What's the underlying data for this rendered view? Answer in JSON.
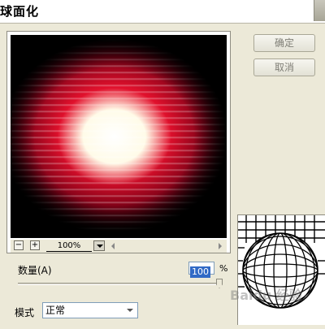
{
  "window": {
    "title": "球面化"
  },
  "buttons": {
    "ok_label": "确定",
    "cancel_label": "取消"
  },
  "preview": {
    "zoom_value": "100%",
    "zoom_out_label": "−",
    "zoom_in_label": "+"
  },
  "amount": {
    "label": "数量(A)",
    "value": "100",
    "unit": "%"
  },
  "mode": {
    "label": "模式",
    "selected": "正常"
  },
  "watermark": {
    "text": "Baidu 经验"
  },
  "colors": {
    "dialog_bg": "#ece9d8",
    "input_highlight": "#316ac5"
  },
  "icons": {
    "zoom_out": "minus-icon",
    "zoom_in": "plus-icon",
    "dropdown": "chevron-down-icon",
    "close": "close-icon"
  }
}
